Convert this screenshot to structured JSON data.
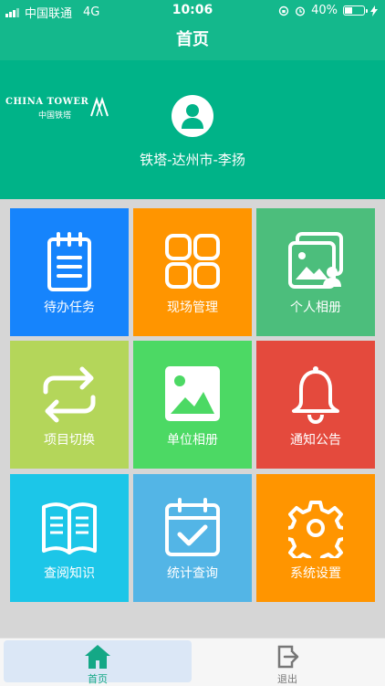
{
  "status_bar": {
    "carrier": "中国联通",
    "network": "4G",
    "time": "10:06",
    "battery_text": "40%",
    "battery_level": 0.4
  },
  "nav": {
    "title": "首页"
  },
  "profile": {
    "logo_en": "CHINA TOWER",
    "logo_cn": "中国铁塔",
    "user_name": "铁塔-达州市-李扬"
  },
  "grid": {
    "tiles": [
      {
        "label": "待办任务",
        "color": "#1684fc",
        "icon": "clipboard-icon"
      },
      {
        "label": "现场管理",
        "color": "#ff9500",
        "icon": "grid-icon"
      },
      {
        "label": "个人相册",
        "color": "#4cbe7c",
        "icon": "photo-user-icon"
      },
      {
        "label": "项目切换",
        "color": "#b4d65a",
        "icon": "switch-icon"
      },
      {
        "label": "单位相册",
        "color": "#4cd964",
        "icon": "image-icon"
      },
      {
        "label": "通知公告",
        "color": "#e44a3d",
        "icon": "bell-icon"
      },
      {
        "label": "查阅知识",
        "color": "#1cc6e8",
        "icon": "book-icon"
      },
      {
        "label": "统计查询",
        "color": "#53b5e6",
        "icon": "calendar-check-icon"
      },
      {
        "label": "系统设置",
        "color": "#ff9500",
        "icon": "gear-icon"
      }
    ]
  },
  "tab_bar": {
    "home_label": "首页",
    "logout_label": "退出",
    "active_color": "#14a886"
  }
}
